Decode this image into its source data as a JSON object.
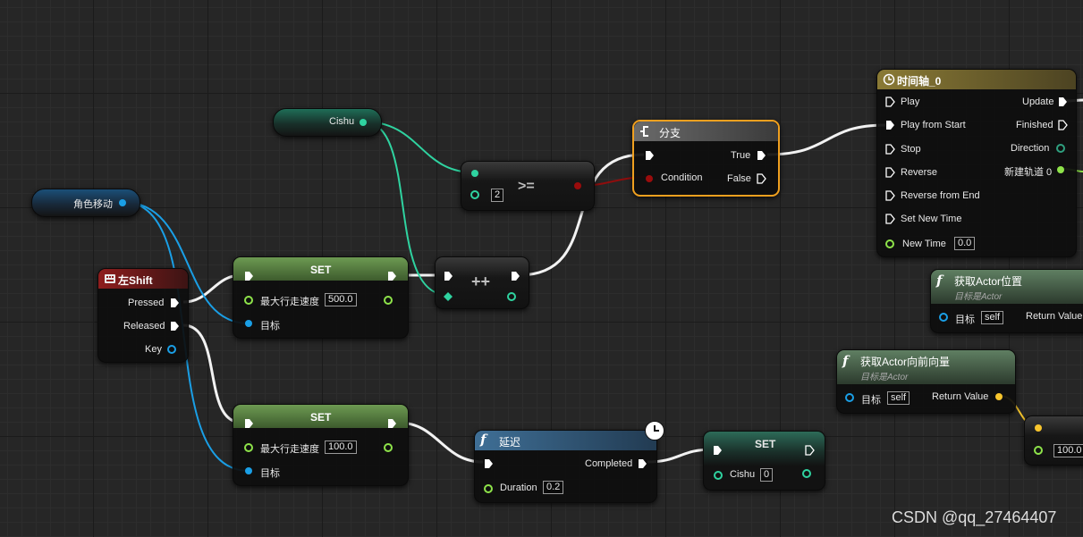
{
  "variables": {
    "cishu": {
      "label": "Cishu"
    },
    "move": {
      "label": "角色移动"
    }
  },
  "left_shift": {
    "title": "左Shift",
    "pressed": "Pressed",
    "released": "Released",
    "key": "Key"
  },
  "set_fast": {
    "title": "SET",
    "field": "最大行走速度",
    "value": "500.0",
    "target": "目标"
  },
  "set_slow": {
    "title": "SET",
    "field": "最大行走速度",
    "value": "100.0",
    "target": "目标"
  },
  "compare": {
    "op": ">=",
    "value": "2"
  },
  "increment": {
    "op": "++"
  },
  "branch": {
    "title": "分支",
    "condition": "Condition",
    "true": "True",
    "false": "False"
  },
  "timeline": {
    "title": "时间轴_0",
    "inputs": [
      "Play",
      "Play from Start",
      "Stop",
      "Reverse",
      "Reverse from End",
      "Set New Time"
    ],
    "new_time_label": "New Time",
    "new_time_value": "0.0",
    "outputs": [
      "Update",
      "Finished",
      "Direction",
      "新建轨道 0"
    ]
  },
  "get_location": {
    "title": "获取Actor位置",
    "subtitle": "目标是Actor",
    "target": "目标",
    "self": "self",
    "return": "Return Value"
  },
  "get_forward": {
    "title": "获取Actor向前向量",
    "subtitle": "目标是Actor",
    "target": "目标",
    "self": "self",
    "return": "Return Value"
  },
  "delay": {
    "title": "延迟",
    "completed": "Completed",
    "duration_label": "Duration",
    "duration_value": "0.2"
  },
  "set_cishu": {
    "title": "SET",
    "field": "Cishu",
    "value": "0"
  },
  "partial_node": {
    "value": "100.0"
  },
  "watermark": "CSDN @qq_27464407",
  "colors": {
    "exec": "#ffffff",
    "object": "#18a0e8",
    "integer": "#2fd3a0",
    "float": "#8ee34a",
    "bool": "#9a0c0c",
    "vector": "#f7c52d",
    "event_header": "#8a1b1b",
    "set_header": "#5c8a43",
    "function_header": "#2b5c83",
    "timeline_header": "#7a6a2c",
    "branch_highlight": "#f0a01f"
  }
}
